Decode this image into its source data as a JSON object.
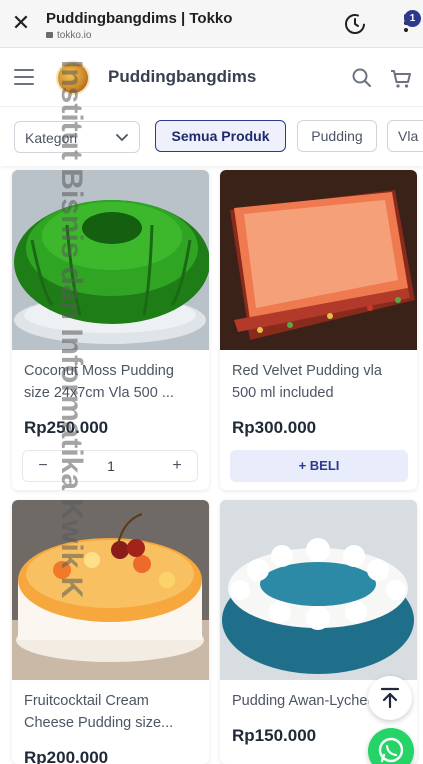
{
  "browser": {
    "title": "Puddingbangdims | Tokko",
    "url": "tokko.io",
    "close_icon": "close-icon",
    "history_icon": "history-icon",
    "menu_icon": "more-vert-icon"
  },
  "header": {
    "store_name": "Puddingbangdims",
    "cart_count": "1",
    "menu_icon": "hamburger-icon",
    "search_icon": "search-icon",
    "cart_icon": "cart-icon"
  },
  "filters": {
    "kategori_label": "Kategori",
    "chips": [
      "Semua Produk",
      "Pudding",
      "Vla"
    ],
    "active_index": 0
  },
  "products": [
    {
      "name": "Coconut Moss Pudding size 24x7cm Vla 500 ...",
      "price": "Rp250.000",
      "quantity": "1",
      "minus": "−",
      "plus": "+"
    },
    {
      "name": "Red Velvet Pudding vla 500 ml included",
      "price": "Rp300.000",
      "button_label": "+ BELI"
    },
    {
      "name": "Fruitcocktail Cream Cheese Pudding size...",
      "price": "Rp200.000"
    },
    {
      "name": "Pudding Awan-Lychee",
      "price": "Rp150.000"
    }
  ],
  "watermark": "Institut Bisnis dan Informatika Kwik K",
  "colors": {
    "accent": "#2b3a8f",
    "beli_bg": "#e8ecfb",
    "whatsapp": "#25d366"
  }
}
